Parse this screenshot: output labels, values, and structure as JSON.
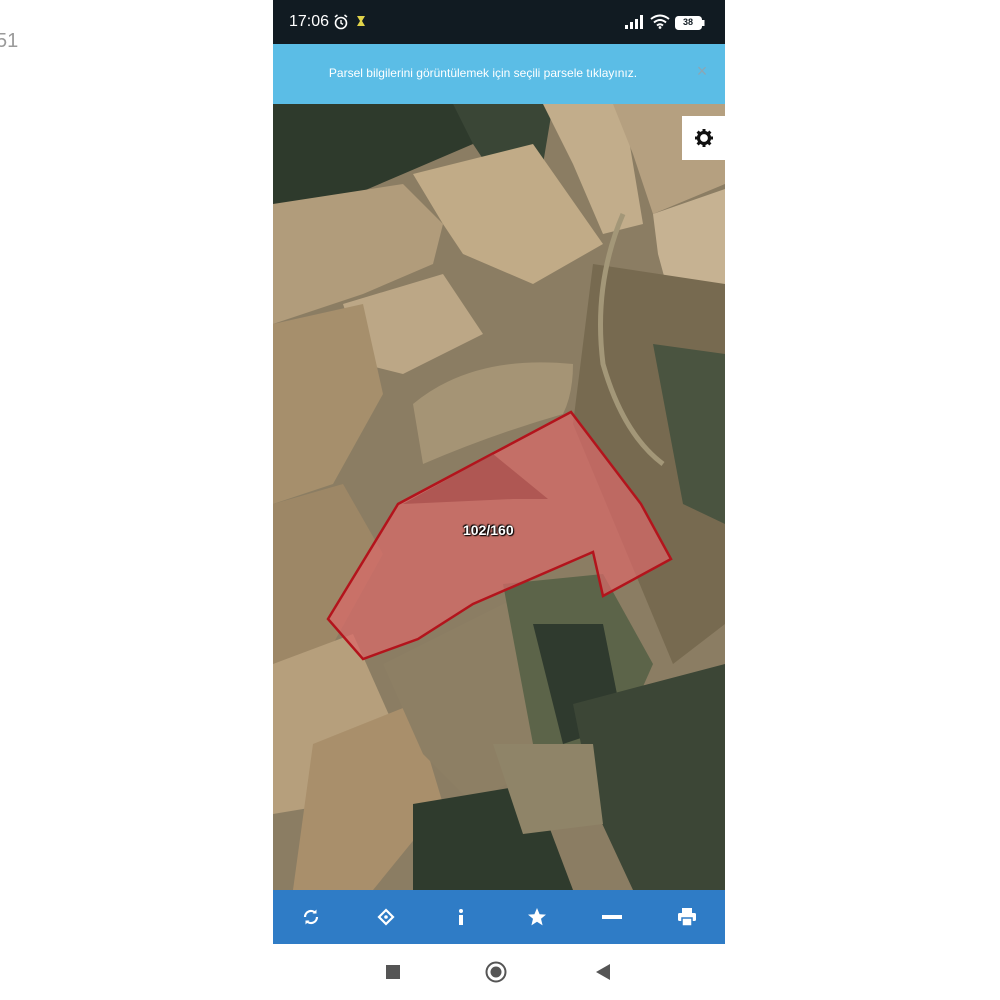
{
  "outer": {
    "fragment_text": "51"
  },
  "status_bar": {
    "time": "17:06",
    "battery": "38"
  },
  "banner": {
    "message": "Parsel bilgilerini görüntülemek için seçili parsele tıklayınız.",
    "close_label": "×"
  },
  "map": {
    "parcel_label": "102/160",
    "parcel_outline_color": "#b3141c",
    "parcel_fill_color": "#d96a6a"
  },
  "toolbar": {
    "items": [
      {
        "icon": "refresh-icon"
      },
      {
        "icon": "locate-icon"
      },
      {
        "icon": "info-icon"
      },
      {
        "icon": "star-icon"
      },
      {
        "icon": "minus-icon"
      },
      {
        "icon": "print-icon"
      }
    ],
    "color": "#2f7cc6"
  },
  "colors": {
    "status_bar": "#111b22",
    "banner": "#5bbde6"
  }
}
